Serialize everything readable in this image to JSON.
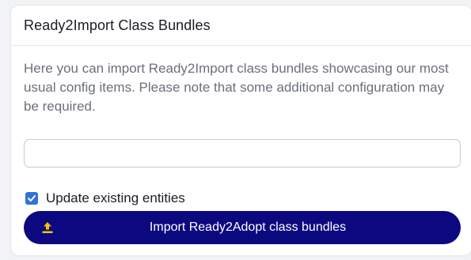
{
  "panel": {
    "title": "Ready2Import Class Bundles",
    "description": "Here you can import Ready2Import class bundles showcasing our most usual config items. Please note that some additional configuration may be required."
  },
  "file_input": {
    "value": "",
    "placeholder": ""
  },
  "update_existing": {
    "label": "Update existing entities",
    "checked": true
  },
  "import_button": {
    "label": "Import Ready2Adopt class bundles",
    "icon": "upload-icon"
  },
  "colors": {
    "button_background": "#0c0980",
    "button_icon": "#f5c400",
    "checkbox": "#2f73d8",
    "description_text": "#6a6f7a"
  }
}
